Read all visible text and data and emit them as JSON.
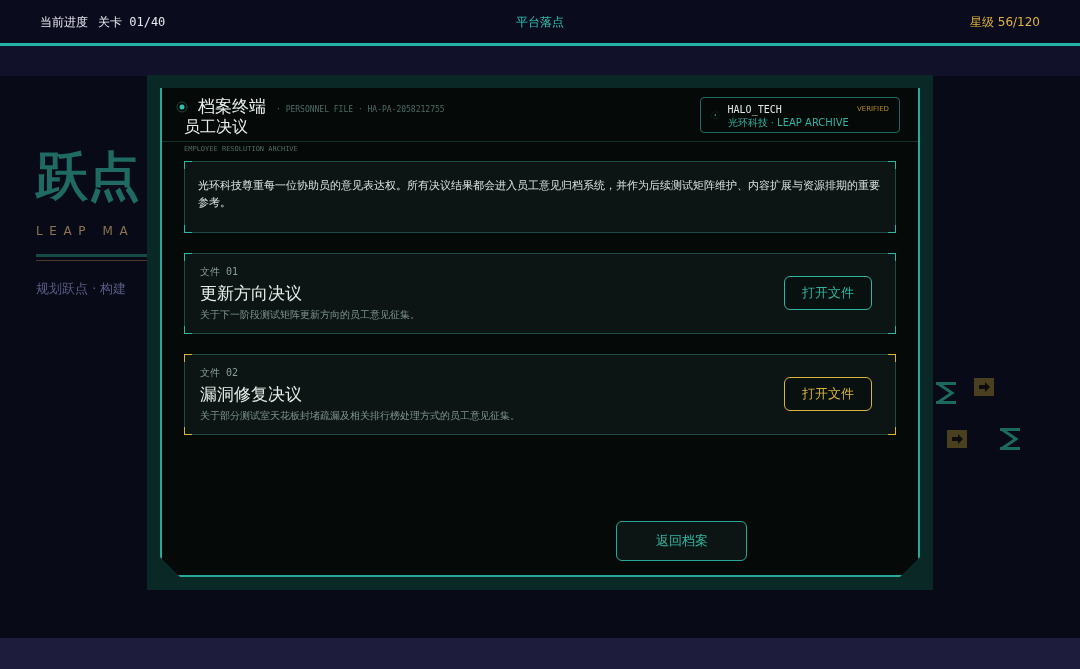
{
  "top_bar": {
    "progress_label": "当前进度",
    "level": "关卡 01/40",
    "title": "平台落点",
    "stars": "星级 56/120"
  },
  "background": {
    "logo": "跃点",
    "subtitle": "LEAP MA",
    "tagline": "规划跃点 · 构建"
  },
  "dialog": {
    "title": "档案终端",
    "file_line": "· PERSONNEL FILE · HA-PA-2058212755",
    "heading": "员工决议",
    "heading_en": "EMPLOYEE RESOLUTION ARCHIVE",
    "badge": {
      "name": "HALO_TECH",
      "sub": "光环科技 · LEAP ARCHIVE",
      "status": "VERIFIED"
    },
    "intro": "光环科技尊重每一位协助员的意见表达权。所有决议结果都会进入员工意见归档系统，并作为后续测试矩阵维护、内容扩展与资源排期的重要参考。",
    "files": [
      {
        "number": "文件 01",
        "title": "更新方向决议",
        "description": "关于下一阶段测试矩阵更新方向的员工意见征集。",
        "button": "打开文件",
        "color": "#2fb5a0"
      },
      {
        "number": "文件 02",
        "title": "漏洞修复决议",
        "description": "关于部分测试室天花板封堵疏漏及相关排行榜处理方式的员工意见征集。",
        "button": "打开文件",
        "color": "#d9b33d"
      }
    ],
    "back_button": "返回档案"
  }
}
